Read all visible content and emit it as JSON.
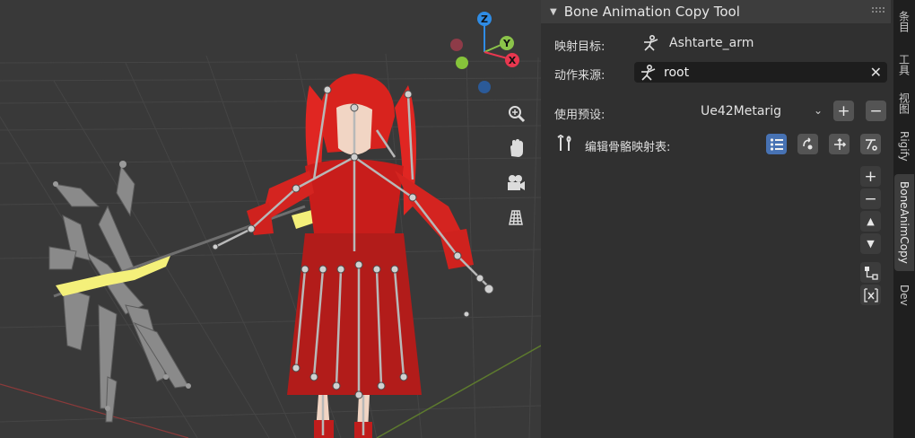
{
  "panel": {
    "title": "Bone Animation Copy Tool",
    "target_label": "映射目标:",
    "target_value": "Ashtarte_arm",
    "source_label": "动作来源:",
    "source_value": "root",
    "preset_label": "使用预设:",
    "preset_value": "Ue42Metarig",
    "add_label": "+",
    "remove_label": "−",
    "edit_map_label": "编辑骨骼映射表:"
  },
  "gizmo": {
    "z": "Z",
    "y": "Y",
    "x": "X"
  },
  "tabs": [
    {
      "label": "条目"
    },
    {
      "label": "工具"
    },
    {
      "label": "视图"
    },
    {
      "label": "Rigify"
    },
    {
      "label": "BoneAnimCopy"
    },
    {
      "label": "Dev"
    }
  ],
  "colors": {
    "accent": "#4772b3",
    "field_bg": "#1d1d1d",
    "axis_x": "#e8374f",
    "axis_y": "#8bc34a",
    "axis_z": "#2f8ce5"
  }
}
